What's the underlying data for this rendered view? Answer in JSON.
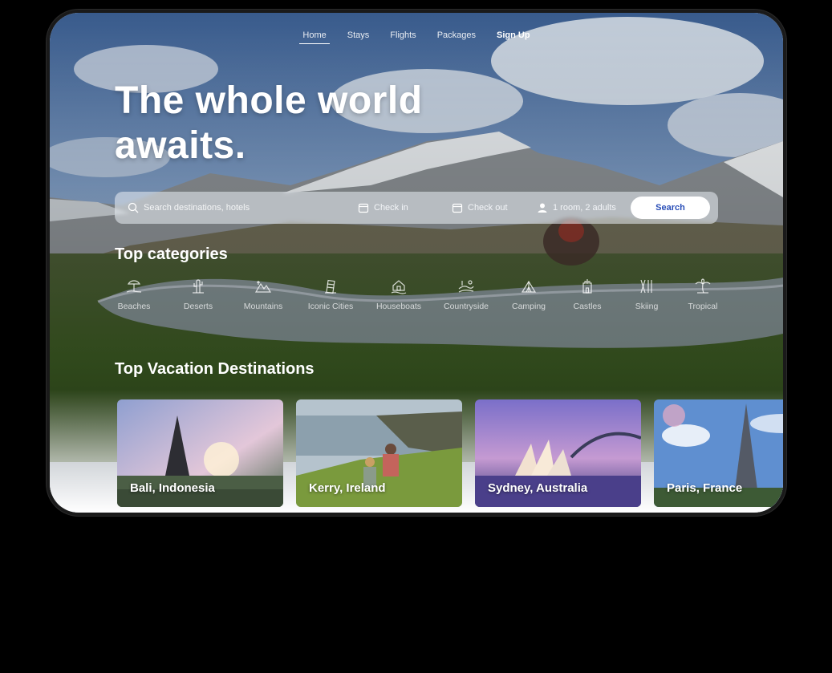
{
  "nav": {
    "items": [
      {
        "label": "Home"
      },
      {
        "label": "Stays"
      },
      {
        "label": "Flights"
      },
      {
        "label": "Packages"
      },
      {
        "label": "Sign Up"
      }
    ]
  },
  "hero": {
    "title_line1": "The whole world",
    "title_line2": "awaits."
  },
  "search": {
    "placeholder": "Search destinations, hotels",
    "check_in": "Check in",
    "check_out": "Check out",
    "guests": "1 room, 2 adults",
    "button": "Search"
  },
  "categories": {
    "title": "Top categories",
    "items": [
      {
        "label": "Beaches",
        "icon": "beach-icon"
      },
      {
        "label": "Deserts",
        "icon": "cactus-icon"
      },
      {
        "label": "Mountains",
        "icon": "mountain-icon"
      },
      {
        "label": "Iconic Cities",
        "icon": "tower-icon"
      },
      {
        "label": "Houseboats",
        "icon": "houseboat-icon"
      },
      {
        "label": "Countryside",
        "icon": "countryside-icon"
      },
      {
        "label": "Camping",
        "icon": "tent-icon"
      },
      {
        "label": "Castles",
        "icon": "castle-icon"
      },
      {
        "label": "Skiing",
        "icon": "ski-icon"
      },
      {
        "label": "Tropical",
        "icon": "palm-icon"
      }
    ]
  },
  "destinations": {
    "title": "Top Vacation Destinations",
    "items": [
      {
        "label": "Bali, Indonesia"
      },
      {
        "label": "Kerry, Ireland"
      },
      {
        "label": "Sydney, Australia"
      },
      {
        "label": "Paris, France"
      }
    ]
  },
  "colors": {
    "accent": "#2a4fb8",
    "frame": "#1a1a1a"
  }
}
